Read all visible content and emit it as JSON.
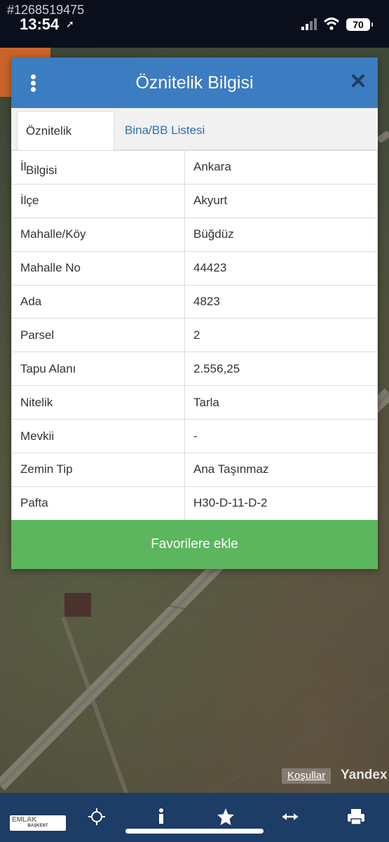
{
  "status_bar": {
    "listing_id": "#1268519475",
    "time": "13:54",
    "battery": "70"
  },
  "modal": {
    "title": "Öznitelik Bilgisi",
    "tabs": [
      {
        "label": "Öznitelik Bilgisi",
        "active": true
      },
      {
        "label": "Bina/BB Listesi",
        "active": false
      }
    ],
    "rows": [
      {
        "key": "İl",
        "value": "Ankara"
      },
      {
        "key": "İlçe",
        "value": "Akyurt"
      },
      {
        "key": "Mahalle/Köy",
        "value": "Büğdüz"
      },
      {
        "key": "Mahalle No",
        "value": "44423"
      },
      {
        "key": "Ada",
        "value": "4823"
      },
      {
        "key": "Parsel",
        "value": "2"
      },
      {
        "key": "Tapu Alanı",
        "value": "2.556,25"
      },
      {
        "key": "Nitelik",
        "value": "Tarla"
      },
      {
        "key": "Mevkii",
        "value": "-"
      },
      {
        "key": "Zemin Tip",
        "value": "Ana Taşınmaz"
      },
      {
        "key": "Pafta",
        "value": "H30-D-11-D-2"
      }
    ],
    "favorite_button": "Favorilere ekle"
  },
  "map": {
    "terms_link": "Koşullar",
    "provider": "Yandex"
  },
  "toolbar": {
    "brand": "EMLAK",
    "brand_sub": "BAŞKENT",
    "buttons": [
      "locate-icon",
      "info-icon",
      "star-icon",
      "measure-icon",
      "print-icon"
    ]
  },
  "colors": {
    "header": "#3c7cc0",
    "tab_link": "#2f6fb0",
    "button": "#5cb65e",
    "toolbar": "#1d3c66"
  }
}
